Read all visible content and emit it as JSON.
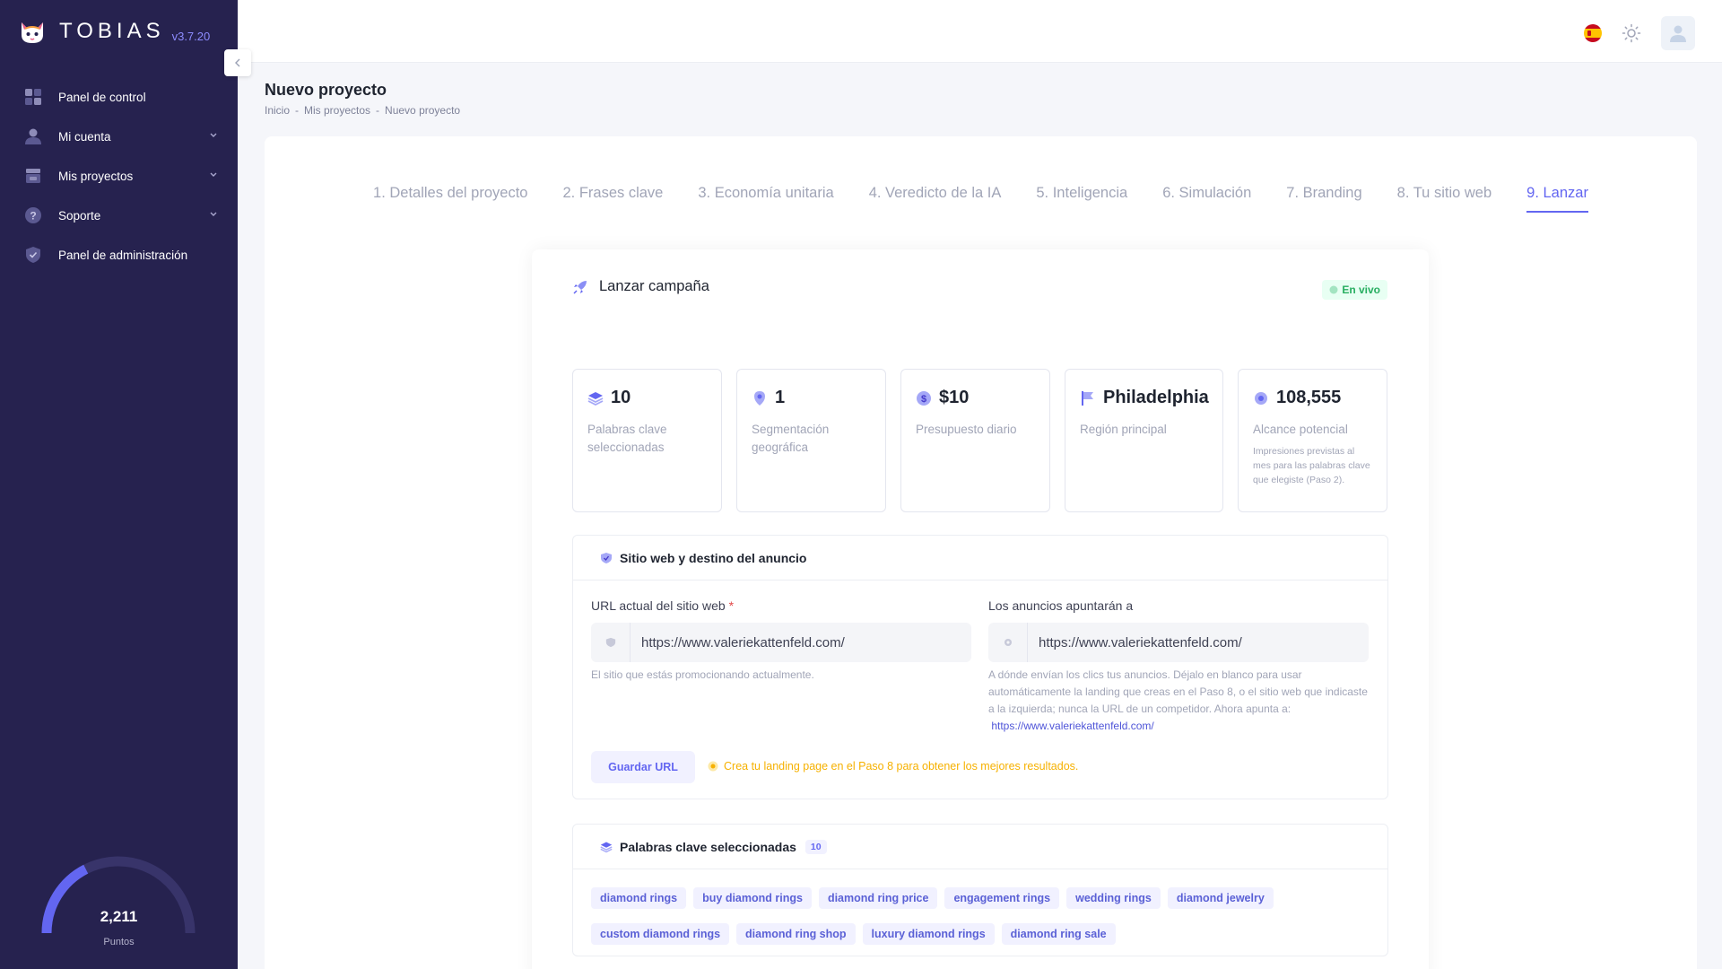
{
  "app": {
    "name": "TOBIAS",
    "version": "v3.7.20"
  },
  "sidebar": {
    "items": [
      {
        "label": "Panel de control",
        "icon": "dashboard-icon",
        "has_chevron": false
      },
      {
        "label": "Mi cuenta",
        "icon": "user-icon",
        "has_chevron": true
      },
      {
        "label": "Mis proyectos",
        "icon": "projects-icon",
        "has_chevron": true
      },
      {
        "label": "Soporte",
        "icon": "help-icon",
        "has_chevron": true
      },
      {
        "label": "Panel de administración",
        "icon": "shield-icon",
        "has_chevron": false
      }
    ],
    "points": {
      "value": "2,211",
      "label": "Puntos",
      "level": 0.35
    }
  },
  "topbar": {
    "language_flag": "spain-flag-icon",
    "theme_icon": "sun-icon",
    "avatar_icon": "user-avatar-icon"
  },
  "page": {
    "title": "Nuevo proyecto",
    "breadcrumb": [
      "Inicio",
      "Mis proyectos",
      "Nuevo proyecto"
    ]
  },
  "tabs": [
    {
      "label": "1. Detalles del proyecto",
      "active": false
    },
    {
      "label": "2. Frases clave",
      "active": false
    },
    {
      "label": "3. Economía unitaria",
      "active": false
    },
    {
      "label": "4. Veredicto de la IA",
      "active": false
    },
    {
      "label": "5. Inteligencia",
      "active": false
    },
    {
      "label": "6. Simulación",
      "active": false
    },
    {
      "label": "7. Branding",
      "active": false
    },
    {
      "label": "8. Tu sitio web",
      "active": false
    },
    {
      "label": "9. Lanzar",
      "active": true
    }
  ],
  "launch": {
    "title": "Lanzar campaña",
    "status": "En vivo",
    "stats": [
      {
        "value": "10",
        "label": "Palabras clave seleccionadas",
        "desc": "",
        "icon": "layers-icon"
      },
      {
        "value": "1",
        "label": "Segmentación geográfica",
        "desc": "",
        "icon": "map-pin-icon"
      },
      {
        "value": "$10",
        "label": "Presupuesto diario",
        "desc": "",
        "icon": "dollar-icon"
      },
      {
        "value": "Philadelphia",
        "label": "Región principal",
        "desc": "",
        "icon": "flag-icon"
      },
      {
        "value": "108,555",
        "label": "Alcance potencial",
        "desc": "Impresiones previstas al mes para las palabras clave que elegiste (Paso 2).",
        "icon": "eye-icon"
      }
    ]
  },
  "website_section": {
    "title": "Sitio web y destino del anuncio",
    "current_url_label": "URL actual del sitio web",
    "required_mark": "*",
    "current_url_value": "https://www.valeriekattenfeld.com/",
    "current_url_help": "El sitio que estás promocionando actualmente.",
    "dest_label": "Los anuncios apuntarán a",
    "dest_value": "https://www.valeriekattenfeld.com/",
    "dest_help": "A dónde envían los clics tus anuncios. Déjalo en blanco para usar automáticamente la landing que creas en el Paso 8, o el sitio web que indicaste a la izquierda; nunca la URL de un competidor. Ahora apunta a:",
    "dest_link": "https://www.valeriekattenfeld.com/",
    "save_button": "Guardar URL",
    "warning": "Crea tu landing page en el Paso 8 para obtener los mejores resultados."
  },
  "keywords_section": {
    "title": "Palabras clave seleccionadas",
    "count": "10",
    "keywords": [
      "diamond rings",
      "buy diamond rings",
      "diamond ring price",
      "engagement rings",
      "wedding rings",
      "diamond jewelry",
      "custom diamond rings",
      "diamond ring shop",
      "luxury diamond rings",
      "diamond ring sale"
    ]
  },
  "colors": {
    "sidebar_bg": "#26224f",
    "accent": "#6366f1",
    "live_green": "#27ae60",
    "warning": "#f6b100"
  }
}
